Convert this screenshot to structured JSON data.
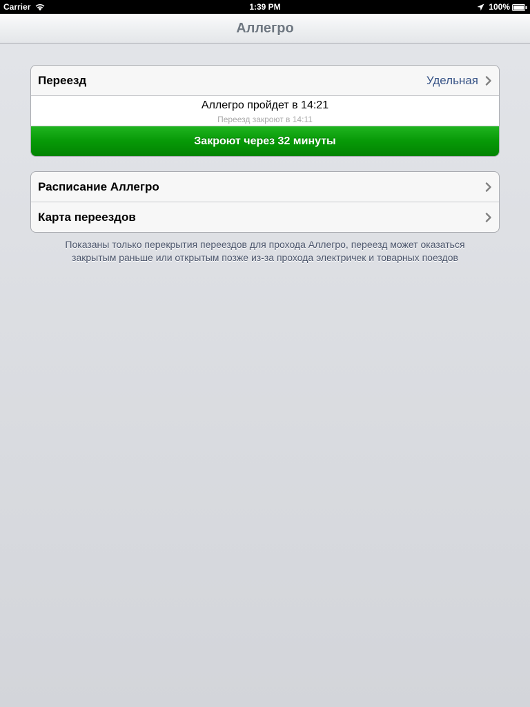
{
  "status_bar": {
    "carrier": "Carrier",
    "time": "1:39 PM",
    "battery": "100%",
    "icons": [
      "wifi-icon",
      "location-icon",
      "battery-icon"
    ]
  },
  "nav": {
    "title": "Аллегро"
  },
  "crossing_section": {
    "crossing_label": "Переезд",
    "crossing_value": "Удельная",
    "train_passes": "Аллегро пройдет в 14:21",
    "closes_at": "Переезд закроют в 14:11",
    "countdown": "Закроют через 32 минуты",
    "countdown_color": "#079907"
  },
  "menu_section": {
    "items": [
      {
        "label": "Расписание Аллегро"
      },
      {
        "label": "Карта переездов"
      }
    ]
  },
  "footer": {
    "note": "Показаны только перекрытия переездов для прохода Аллегро, переезд может оказаться закрытым раньше или открытым позже из-за прохода электричек и товарных поездов"
  },
  "colors": {
    "accent_value": "#385487",
    "nav_title": "#6e7781"
  }
}
